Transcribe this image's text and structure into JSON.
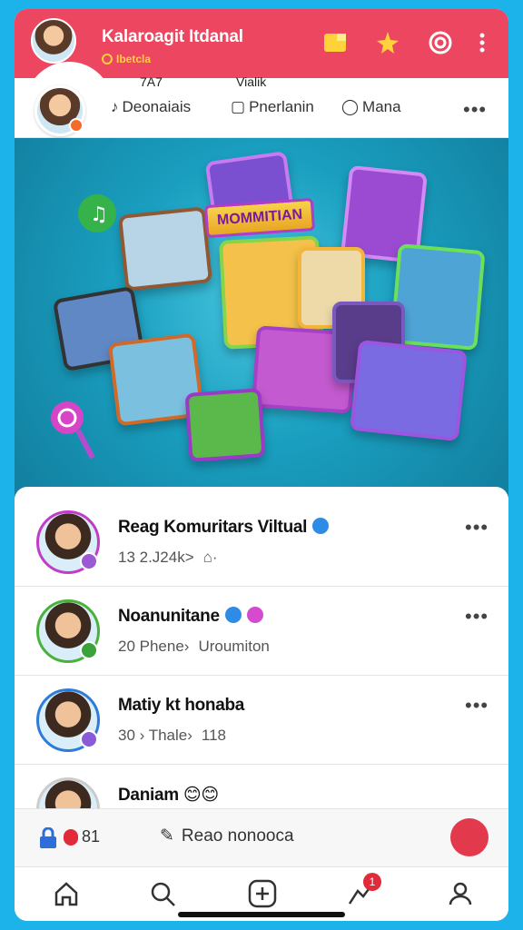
{
  "header": {
    "title": "Kalaroagit Itdanal",
    "subtitle": "Ibetcla",
    "icons": [
      "folder-icon",
      "sparkle-icon",
      "camera-icon",
      "kebab-icon"
    ]
  },
  "profile_strip": {
    "stats": [
      "7A7",
      "Vialik"
    ],
    "actions": [
      {
        "label": "Deonaiais",
        "icon": "music-note-icon"
      },
      {
        "label": "Pnerlanin",
        "icon": "chat-bubble-icon"
      },
      {
        "label": "Mana",
        "icon": "comment-icon"
      }
    ],
    "more": "•••"
  },
  "banner": {
    "sign_text": "MOMMITIAN"
  },
  "feed": [
    {
      "name": "Reag Komuritars Viltual",
      "meta": [
        "13 2.J24k>",
        "⌂·"
      ],
      "ring": "#c13cc7",
      "badge": "#9b59d6"
    },
    {
      "name": "Noanunitane",
      "meta": [
        "20 Phene›",
        "Uroumiton"
      ],
      "ring": "#48b23a",
      "badge": "#3aa33a"
    },
    {
      "name": "Matiy kt honaba",
      "meta": [
        "30 › Thale›",
        "118"
      ],
      "ring": "#2e7bd9",
      "badge": "#8a5bd6"
    },
    {
      "name": "Daniam",
      "meta": [
        "😊😊"
      ],
      "ring": "#cccccc",
      "badge": "#cccccc"
    }
  ],
  "composer": {
    "badge_count": "81",
    "placeholder": "Reao nonooca"
  },
  "tabs": {
    "notification_count": "1"
  },
  "colors": {
    "header": "#ec4660",
    "background": "#1cb3ea",
    "verified": "#2e8ce6"
  }
}
